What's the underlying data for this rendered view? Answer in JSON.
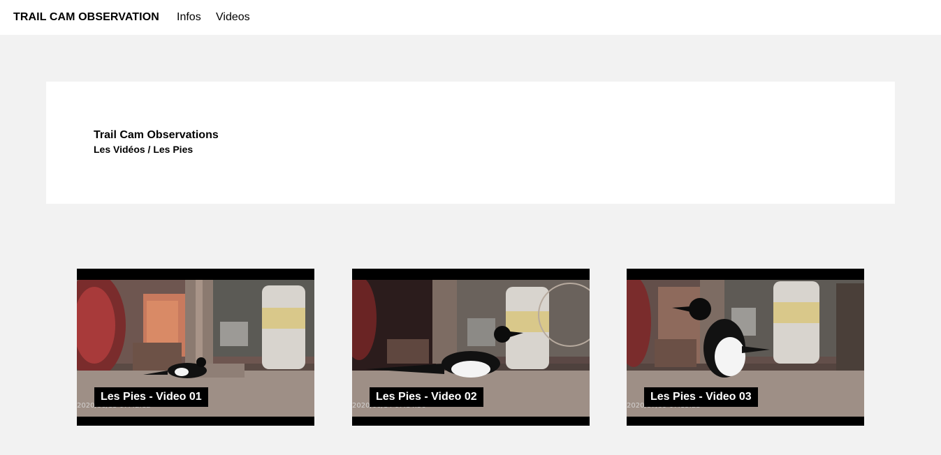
{
  "header": {
    "brand": "TRAIL CAM OBSERVATION",
    "nav": [
      {
        "label": "Infos"
      },
      {
        "label": "Videos"
      }
    ]
  },
  "hero": {
    "title": "Trail Cam Observations",
    "subtitle": "Les Vidéos / Les Pies"
  },
  "videos": [
    {
      "title": "Les Pies - Video 01",
      "timestamp": "2020/06/13  07:42:12"
    },
    {
      "title": "Les Pies - Video 02",
      "timestamp": "2020/06/14  07:14:56"
    },
    {
      "title": "Les Pies - Video 03",
      "timestamp": "2020/07/09  07:15:23"
    }
  ]
}
